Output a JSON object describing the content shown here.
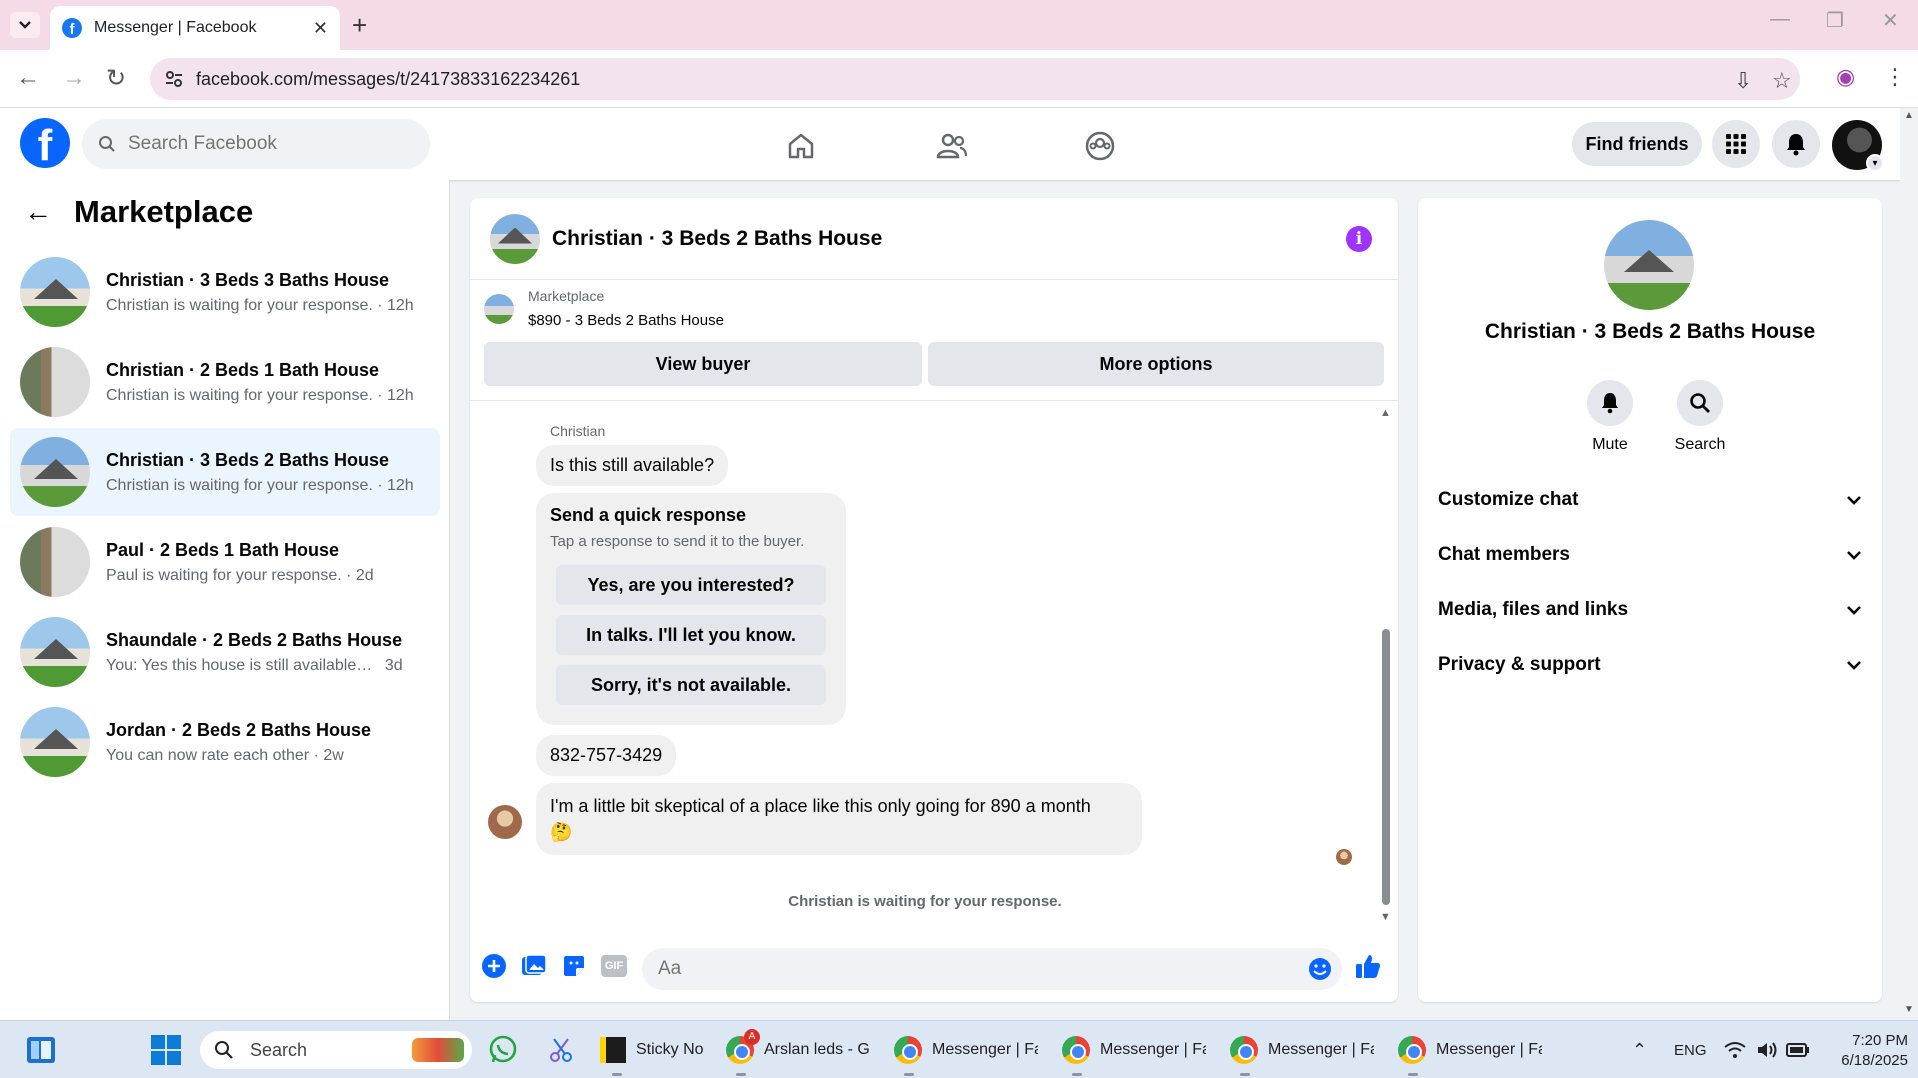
{
  "browser": {
    "tab_title": "Messenger | Facebook",
    "url": "facebook.com/messages/t/24173833162234261"
  },
  "header": {
    "search_placeholder": "Search Facebook",
    "find_friends": "Find friends"
  },
  "sidebar": {
    "title": "Marketplace",
    "conversations": [
      {
        "name": "Christian · 3 Beds 3 Baths House",
        "preview": "Christian is waiting for your response.",
        "time": "12h"
      },
      {
        "name": "Christian · 2 Beds 1 Bath House",
        "preview": "Christian is waiting for your response.",
        "time": "12h"
      },
      {
        "name": "Christian · 3 Beds 2 Baths House",
        "preview": "Christian is waiting for your response.",
        "time": "12h"
      },
      {
        "name": "Paul · 2 Beds 1 Bath House",
        "preview": "Paul is waiting for your response.",
        "time": "2d"
      },
      {
        "name": "Shaundale · 2 Beds 2 Baths House",
        "preview": "You: Yes this house is still available for...",
        "time": "3d"
      },
      {
        "name": "Jordan · 2 Beds 2 Baths House",
        "preview": "You can now rate each other",
        "time": "2w"
      }
    ]
  },
  "chat": {
    "title": "Christian · 3 Beds 2 Baths House",
    "listing_source": "Marketplace",
    "listing_detail": "$890 - 3 Beds 2 Baths House",
    "view_buyer": "View buyer",
    "more_options": "More options",
    "sender": "Christian",
    "messages": [
      "Is this still available?",
      "832-757-3429",
      "I'm a little bit skeptical of a place like this only going for 890 a month",
      "🤔"
    ],
    "quick_response": {
      "heading": "Send a quick response",
      "subheading": "Tap a response to send it to the buyer.",
      "options": [
        "Yes, are you interested?",
        "In talks. I'll let you know.",
        "Sorry, it's not available."
      ]
    },
    "waiting_note": "Christian is waiting for your response.",
    "composer_placeholder": "Aa",
    "gif_label": "GIF"
  },
  "details": {
    "name": "Christian · 3 Beds 2 Baths House",
    "actions": [
      "Mute",
      "Search"
    ],
    "sections": [
      "Customize chat",
      "Chat members",
      "Media, files and links",
      "Privacy & support"
    ]
  },
  "taskbar": {
    "search": "Search",
    "apps": [
      "Sticky No",
      "Arslan leds - Gc",
      "Messenger | Fa",
      "Messenger | Fa",
      "Messenger | Fa",
      "Messenger | Fa"
    ],
    "badge": "A",
    "lang": "ENG",
    "time": "7:20 PM",
    "date": "6/18/2025"
  },
  "colors": {
    "fb_blue": "#0866ff",
    "info_purple": "#a033ff",
    "active_row": "#ebf5ff",
    "tab_strip": "#f5dbe8"
  }
}
